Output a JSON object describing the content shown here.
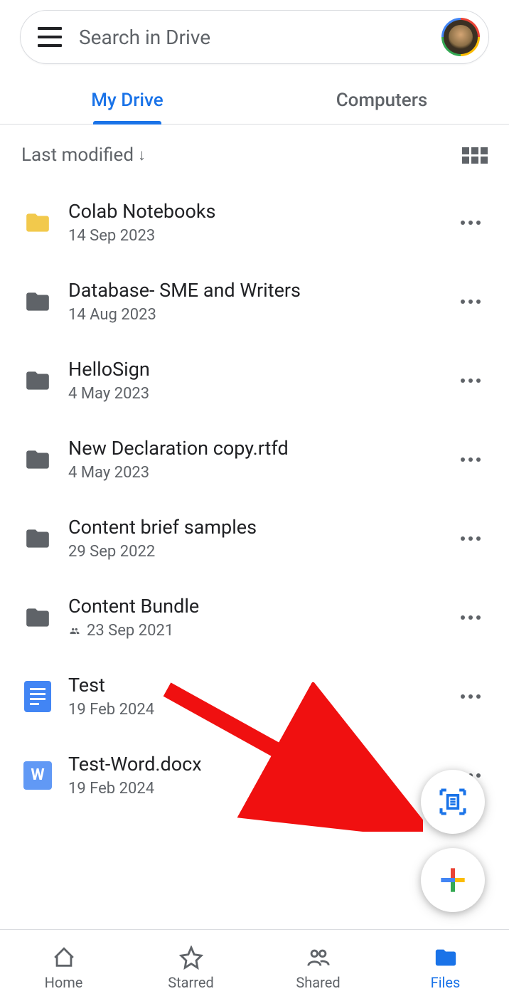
{
  "search": {
    "placeholder": "Search in Drive"
  },
  "tabs": [
    {
      "label": "My Drive",
      "active": true
    },
    {
      "label": "Computers",
      "active": false
    }
  ],
  "sort": {
    "label": "Last modified"
  },
  "files": [
    {
      "name": "Colab Notebooks",
      "date": "14 Sep 2023",
      "type": "folder-yellow",
      "shared": false
    },
    {
      "name": "Database- SME and Writers",
      "date": "14 Aug 2023",
      "type": "folder-gray",
      "shared": false
    },
    {
      "name": "HelloSign",
      "date": "4 May 2023",
      "type": "folder-gray",
      "shared": false
    },
    {
      "name": "New Declaration copy.rtfd",
      "date": "4 May 2023",
      "type": "folder-gray",
      "shared": false
    },
    {
      "name": "Content brief samples",
      "date": "29 Sep 2022",
      "type": "folder-gray",
      "shared": false
    },
    {
      "name": "Content Bundle",
      "date": "23 Sep 2021",
      "type": "folder-gray",
      "shared": true
    },
    {
      "name": "Test",
      "date": "19 Feb 2024",
      "type": "docs",
      "shared": false
    },
    {
      "name": "Test-Word.docx",
      "date": "19 Feb 2024",
      "type": "word",
      "shared": false
    }
  ],
  "bottom_nav": [
    {
      "label": "Home",
      "icon": "home",
      "active": false
    },
    {
      "label": "Starred",
      "icon": "star",
      "active": false
    },
    {
      "label": "Shared",
      "icon": "shared",
      "active": false
    },
    {
      "label": "Files",
      "icon": "files",
      "active": true
    }
  ]
}
